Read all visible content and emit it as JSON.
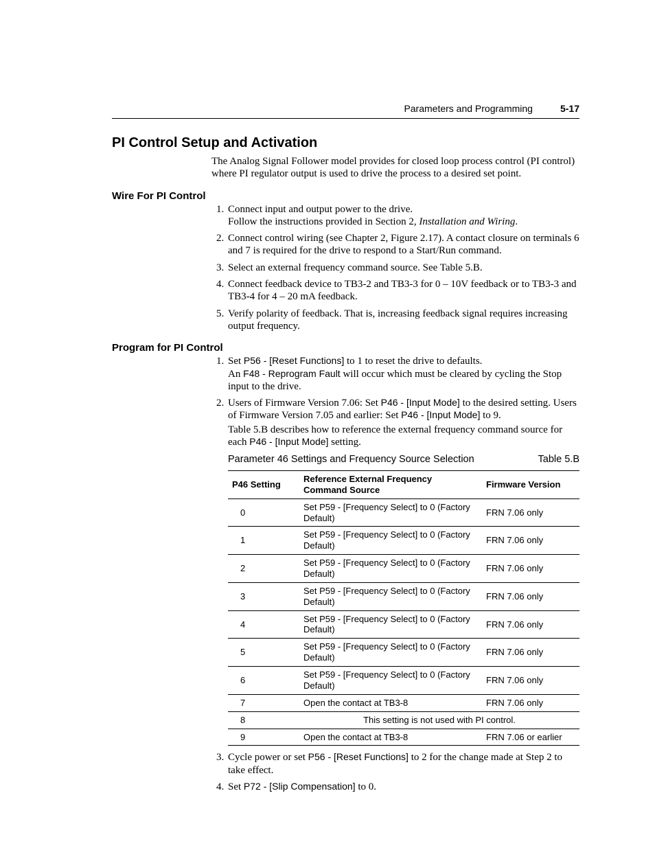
{
  "header": {
    "chapter": "Parameters and Programming",
    "page": "5-17"
  },
  "h1": "PI Control Setup and Activation",
  "intro": "The Analog Signal Follower model provides for closed loop process control (PI control) where PI regulator output is used to drive the process to a desired set point.",
  "wire": {
    "heading": "Wire For PI Control",
    "items": {
      "i1a": "Connect input and output power to the drive.",
      "i1b_pre": "Follow the instructions provided in Section 2, ",
      "i1b_ital": "Installation and Wiring",
      "i1b_post": ".",
      "i2": "Connect control wiring (see Chapter 2, Figure 2.17). A contact closure on terminals 6 and 7 is required for the drive to respond to a Start/Run command.",
      "i3": "Select an external frequency command source. See Table 5.B.",
      "i4": "Connect feedback device to TB3-2 and TB3-3 for 0 – 10V feedback or to TB3-3 and TB3-4 for 4 – 20 mA feedback.",
      "i5": "Verify polarity of feedback. That is, increasing feedback signal requires increasing output frequency."
    }
  },
  "program": {
    "heading": "Program for PI Control",
    "i1": {
      "a1": "Set ",
      "p56": "P56 - [Reset Functions]",
      "a2": " to 1 to reset the drive to defaults.",
      "b1": "An ",
      "f48": "F48 - Reprogram Fault",
      "b2": " will occur which must be cleared by cycling the Stop input to the drive."
    },
    "i2": {
      "a1": "Users of Firmware Version 7.06: Set ",
      "p46": "P46 - [Input Mode]",
      "a2": " to the desired setting. Users of Firmware Version 7.05 and earlier: Set ",
      "a3": " to 9.",
      "b1": "Table 5.B describes how to reference the external frequency command source for each ",
      "b2": " setting."
    },
    "i3": {
      "a1": "Cycle power or set ",
      "p56": "P56 - [Reset Functions]",
      "a2": " to 2 for the change made at Step 2 to take effect."
    },
    "i4": {
      "a1": "Set ",
      "p72": "P72 - [Slip Compensation]",
      "a2": " to 0."
    }
  },
  "table": {
    "caption_left": "Parameter 46 Settings and Frequency Source Selection",
    "caption_right": "Table 5.B",
    "cols": {
      "c0": "P46 Setting",
      "c1": "Reference External Frequency Command Source",
      "c2": "Firmware Version"
    },
    "rows": [
      {
        "s": "0",
        "r": "Set P59 - [Frequency Select] to 0 (Factory Default)",
        "f": "FRN 7.06 only"
      },
      {
        "s": "1",
        "r": "Set P59 - [Frequency Select] to 0 (Factory Default)",
        "f": "FRN 7.06 only"
      },
      {
        "s": "2",
        "r": "Set P59 - [Frequency Select] to 0 (Factory Default)",
        "f": "FRN 7.06 only"
      },
      {
        "s": "3",
        "r": "Set P59 - [Frequency Select] to 0 (Factory Default)",
        "f": "FRN 7.06 only"
      },
      {
        "s": "4",
        "r": "Set P59 - [Frequency Select] to 0 (Factory Default)",
        "f": "FRN 7.06 only"
      },
      {
        "s": "5",
        "r": "Set P59 - [Frequency Select] to 0 (Factory Default)",
        "f": "FRN 7.06 only"
      },
      {
        "s": "6",
        "r": "Set P59 - [Frequency Select] to 0 (Factory Default)",
        "f": "FRN 7.06 only"
      },
      {
        "s": "7",
        "r": "Open the contact at TB3-8",
        "f": "FRN 7.06 only"
      },
      {
        "s": "8",
        "r": "This setting is not used with PI control.",
        "f": "",
        "span": true
      },
      {
        "s": "9",
        "r": "Open the contact at TB3-8",
        "f": "FRN 7.06 or earlier"
      }
    ]
  }
}
